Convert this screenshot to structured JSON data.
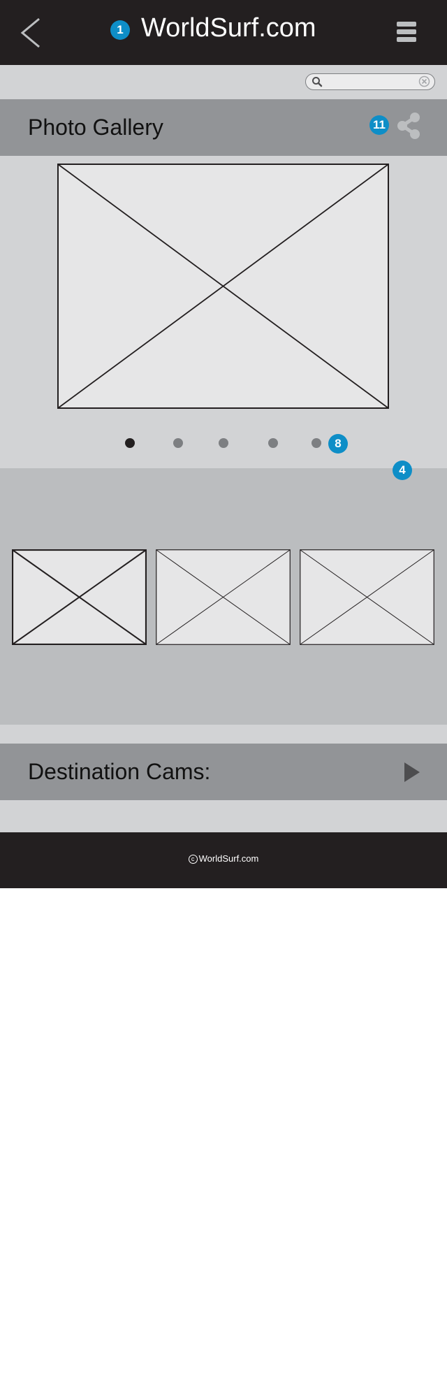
{
  "header": {
    "title": "WorldSurf.com",
    "badge": "1",
    "back_icon": "chevron-left-icon",
    "menu_icon": "hamburger-menu-icon"
  },
  "search": {
    "placeholder": "",
    "value": "",
    "search_icon": "search-icon",
    "clear_icon": "clear-icon"
  },
  "gallery": {
    "title": "Photo Gallery",
    "share_badge": "11",
    "share_icon": "share-icon",
    "dots_badge": "8",
    "thumbs_badge": "4",
    "dots": [
      {
        "active": true
      },
      {
        "active": false
      },
      {
        "active": false
      },
      {
        "active": false
      },
      {
        "active": false
      }
    ]
  },
  "cams": {
    "title": "Destination Cams:",
    "arrow_icon": "play-arrow-icon"
  },
  "footer": {
    "copyright_symbol": "c",
    "text": "WorldSurf.com"
  },
  "colors": {
    "header_bg": "#231f20",
    "badge": "#0e8ec7",
    "section_header_bg": "#929497",
    "light_band": "#d2d3d5",
    "thumb_band": "#bbbdbf",
    "placeholder_fill": "#e6e6e7"
  }
}
